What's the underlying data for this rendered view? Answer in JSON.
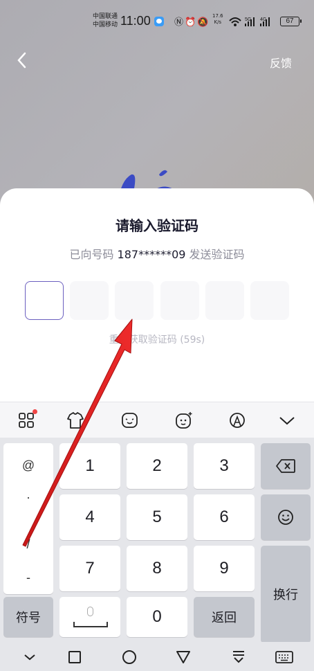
{
  "status_bar": {
    "carrier_1": "中国联通",
    "carrier_2": "中国移动",
    "time": "11:00",
    "speed_value": "17.6",
    "speed_unit": "K/s",
    "signal_1_label": "5G",
    "signal_2_label": "4G",
    "battery": "67"
  },
  "header": {
    "feedback_label": "反馈"
  },
  "verify": {
    "title": "请输入验证码",
    "subtitle_prefix": "已向号码 ",
    "phone": "187******09",
    "subtitle_suffix": " 发送验证码",
    "resend": "重新获取验证码 (59s)"
  },
  "keyboard": {
    "symbols": [
      "@",
      ".",
      "/",
      "-"
    ],
    "digits": [
      "1",
      "2",
      "3",
      "4",
      "5",
      "6",
      "7",
      "8",
      "9",
      "0"
    ],
    "symbol_key": "符号",
    "return_key": "返回",
    "enter_key": "换行"
  },
  "colors": {
    "accent_border": "#6b5fbf",
    "annotation_arrow": "#e02020"
  }
}
